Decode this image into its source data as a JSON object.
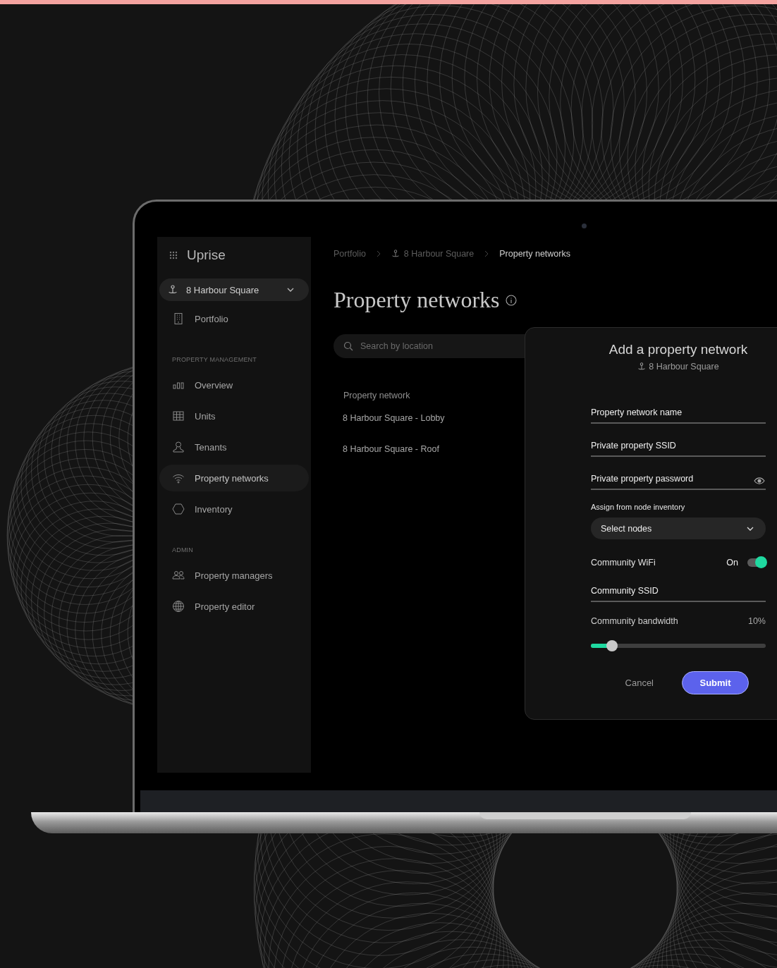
{
  "app": {
    "name": "Uprise"
  },
  "sidebar": {
    "property_selector": "8 Harbour Square",
    "top_items": [
      {
        "label": "Portfolio",
        "selected": false
      }
    ],
    "sections": [
      {
        "heading": "PROPERTY MANAGEMENT",
        "items": [
          {
            "label": "Overview",
            "selected": false
          },
          {
            "label": "Units",
            "selected": false
          },
          {
            "label": "Tenants",
            "selected": false
          },
          {
            "label": "Property networks",
            "selected": true
          },
          {
            "label": "Inventory",
            "selected": false
          }
        ]
      },
      {
        "heading": "ADMIN",
        "items": [
          {
            "label": "Property managers",
            "selected": false
          },
          {
            "label": "Property editor",
            "selected": false
          }
        ]
      }
    ]
  },
  "breadcrumb": [
    {
      "label": "Portfolio",
      "current": false
    },
    {
      "label": "8 Harbour Square",
      "current": false
    },
    {
      "label": "Property networks",
      "current": true
    }
  ],
  "page_title": "Property networks",
  "search": {
    "placeholder": "Search by location"
  },
  "table": {
    "columns": [
      "Property network"
    ],
    "rows": [
      "8 Harbour Square - Lobby",
      "8 Harbour Square - Roof"
    ]
  },
  "modal": {
    "title": "Add a property network",
    "subtitle": "8 Harbour Square",
    "fields": [
      {
        "kind": "text",
        "placeholder": "Property network name"
      },
      {
        "kind": "text",
        "placeholder": "Private property SSID"
      },
      {
        "kind": "password",
        "placeholder": "Private property password"
      },
      {
        "kind": "select",
        "label": "Assign from node inventory",
        "placeholder": "Select nodes"
      },
      {
        "kind": "toggle",
        "label": "Community WiFi",
        "state_text": "On",
        "on": true
      },
      {
        "kind": "text",
        "placeholder": "Community SSID"
      },
      {
        "kind": "slider",
        "label": "Community bandwidth",
        "reading": "10%",
        "level": 0.12
      }
    ],
    "buttons": {
      "cancel": "Cancel",
      "submit": "Submit"
    }
  }
}
